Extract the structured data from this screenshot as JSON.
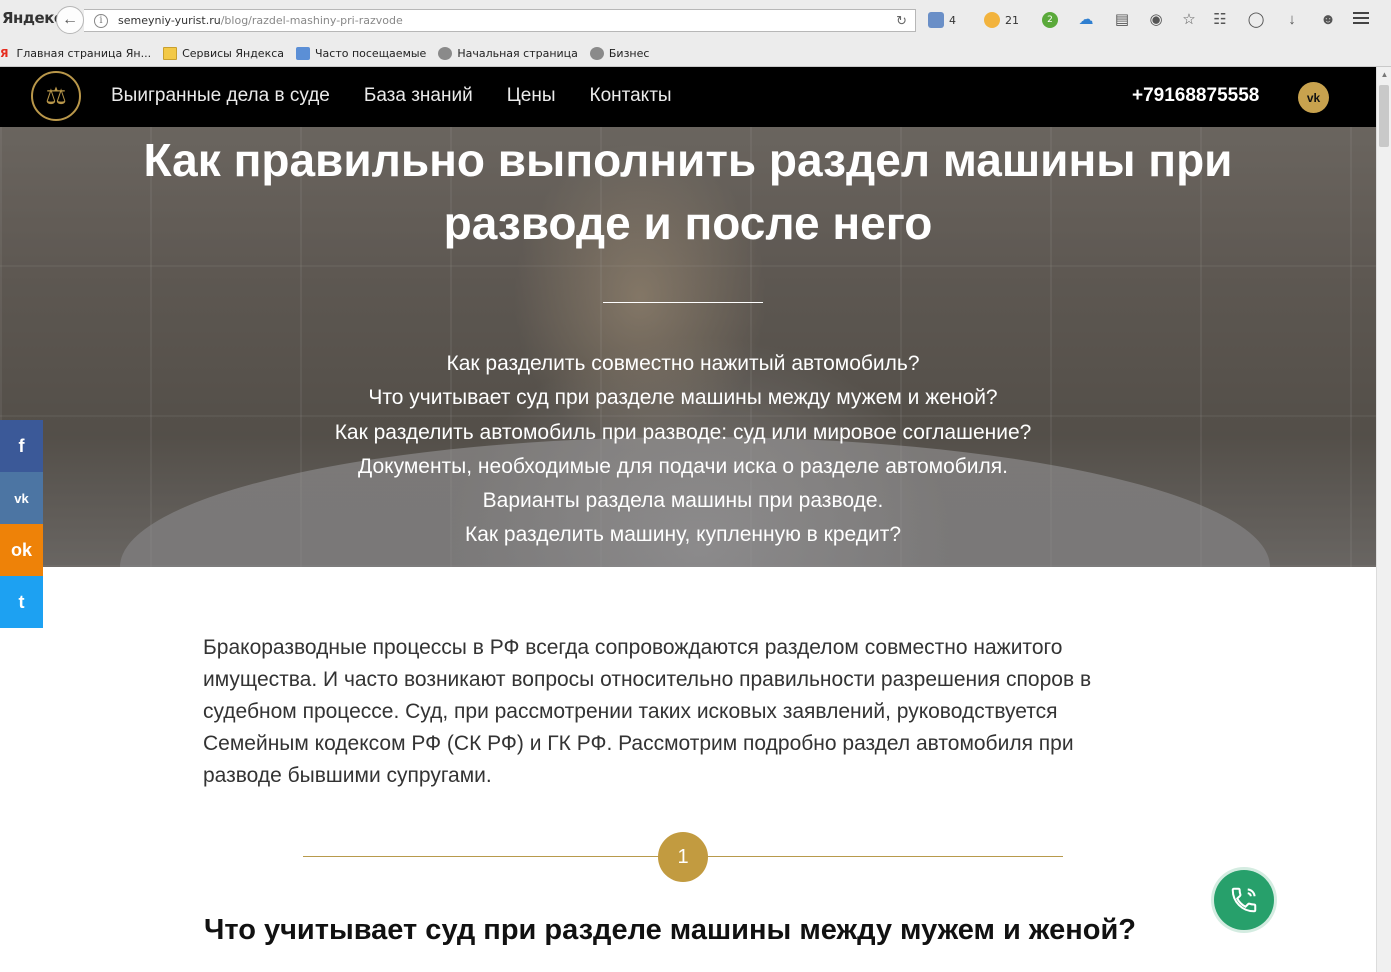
{
  "browser": {
    "yandex_logo": "Яндекс",
    "url_domain": "semeyniy-yurist.ru",
    "url_path": "/blog/razdel-mashiny-pri-razvode",
    "mail_count": "4",
    "weather_count": "21",
    "badge_count": "2",
    "bookmarks": [
      {
        "label": "Главная страница Ян..."
      },
      {
        "label": "Сервисы Яндекса"
      },
      {
        "label": "Часто посещаемые"
      },
      {
        "label": "Начальная страница"
      },
      {
        "label": "Бизнес"
      }
    ]
  },
  "header": {
    "nav": [
      {
        "label": "Выигранные дела в суде"
      },
      {
        "label": "База знаний"
      },
      {
        "label": "Цены"
      },
      {
        "label": "Контакты"
      }
    ],
    "phone": "+79168875558",
    "vk_label": "vk"
  },
  "hero": {
    "title_line1": "Как правильно выполнить раздел машины при",
    "title_line2": "разводе и после него",
    "toc": [
      "Как разделить совместно нажитый автомобиль?",
      "Что учитывает суд при разделе машины между мужем и женой?",
      "Как разделить автомобиль при разводе: суд или мировое соглашение?",
      "Документы, необходимые для подачи иска о разделе автомобиля.",
      "Варианты раздела машины при разводе.",
      "Как разделить машину, купленную в кредит?"
    ]
  },
  "share": {
    "fb": "f",
    "vk": "vk",
    "ok": "ok",
    "tw": "t"
  },
  "article": {
    "intro": "Бракоразводные процессы в РФ всегда сопровождаются разделом совместно нажитого имущества. И часто возникают вопросы относительно правильности разрешения споров в судебном процессе. Суд, при рассмотрении таких исковых заявлений, руководствуется Семейным кодексом РФ (СК РФ) и ГК РФ. Рассмотрим подробно раздел автомобиля при разводе бывшими супругами.",
    "section_number": "1",
    "section_title": "Что учитывает суд при разделе машины между мужем и женой?"
  },
  "colors": {
    "accent_gold": "#c29b40",
    "header_bg": "#000000",
    "call_green": "#27a06b",
    "facebook": "#3b5998",
    "vk": "#4c75a3",
    "odnoklassniki": "#ee8208",
    "twitter": "#1da1f2"
  }
}
